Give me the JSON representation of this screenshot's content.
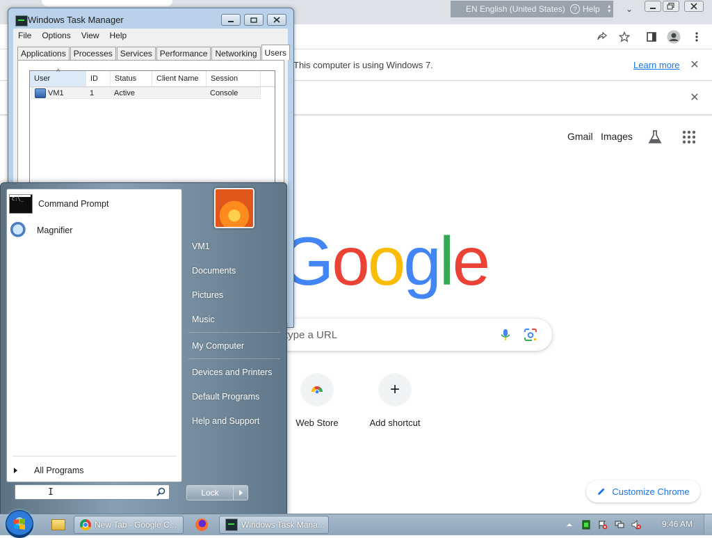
{
  "chrome": {
    "lang_bar": {
      "language": "EN English (United States)",
      "help": "Help"
    },
    "infobar": {
      "message": "This computer is using Windows 7.",
      "learn_more": "Learn more"
    },
    "ntp_links": {
      "gmail": "Gmail",
      "images": "Images"
    },
    "google_logo": {
      "letters": [
        "G",
        "o",
        "o",
        "g",
        "l",
        "e"
      ]
    },
    "search": {
      "placeholder": "type a URL"
    },
    "shortcuts": [
      {
        "label": "Web Store",
        "icon": "web-store-icon"
      },
      {
        "label": "Add shortcut",
        "icon": "plus-icon"
      }
    ],
    "customize": "Customize Chrome"
  },
  "taskmgr": {
    "title": "Windows Task Manager",
    "menu": [
      "File",
      "Options",
      "View",
      "Help"
    ],
    "tabs": [
      "Applications",
      "Processes",
      "Services",
      "Performance",
      "Networking",
      "Users"
    ],
    "active_tab": "Users",
    "columns": [
      "User",
      "ID",
      "Status",
      "Client Name",
      "Session"
    ],
    "rows": [
      {
        "user": "VM1",
        "id": "1",
        "status": "Active",
        "client_name": "",
        "session": "Console"
      }
    ]
  },
  "start_menu": {
    "pinned": [
      {
        "label": "Command Prompt",
        "icon": "command-prompt-icon"
      },
      {
        "label": "Magnifier",
        "icon": "magnifier-icon"
      }
    ],
    "all_programs": "All Programs",
    "search_value": "",
    "right_links": {
      "user": "VM1",
      "documents": "Documents",
      "pictures": "Pictures",
      "music": "Music",
      "computer": "My Computer",
      "devices": "Devices and Printers",
      "defaults": "Default Programs",
      "help": "Help and Support"
    },
    "lock": "Lock"
  },
  "taskbar": {
    "buttons": {
      "chrome": "New Tab - Google C...",
      "taskmgr": "Windows Task Mana..."
    },
    "clock": "9:46 AM"
  }
}
